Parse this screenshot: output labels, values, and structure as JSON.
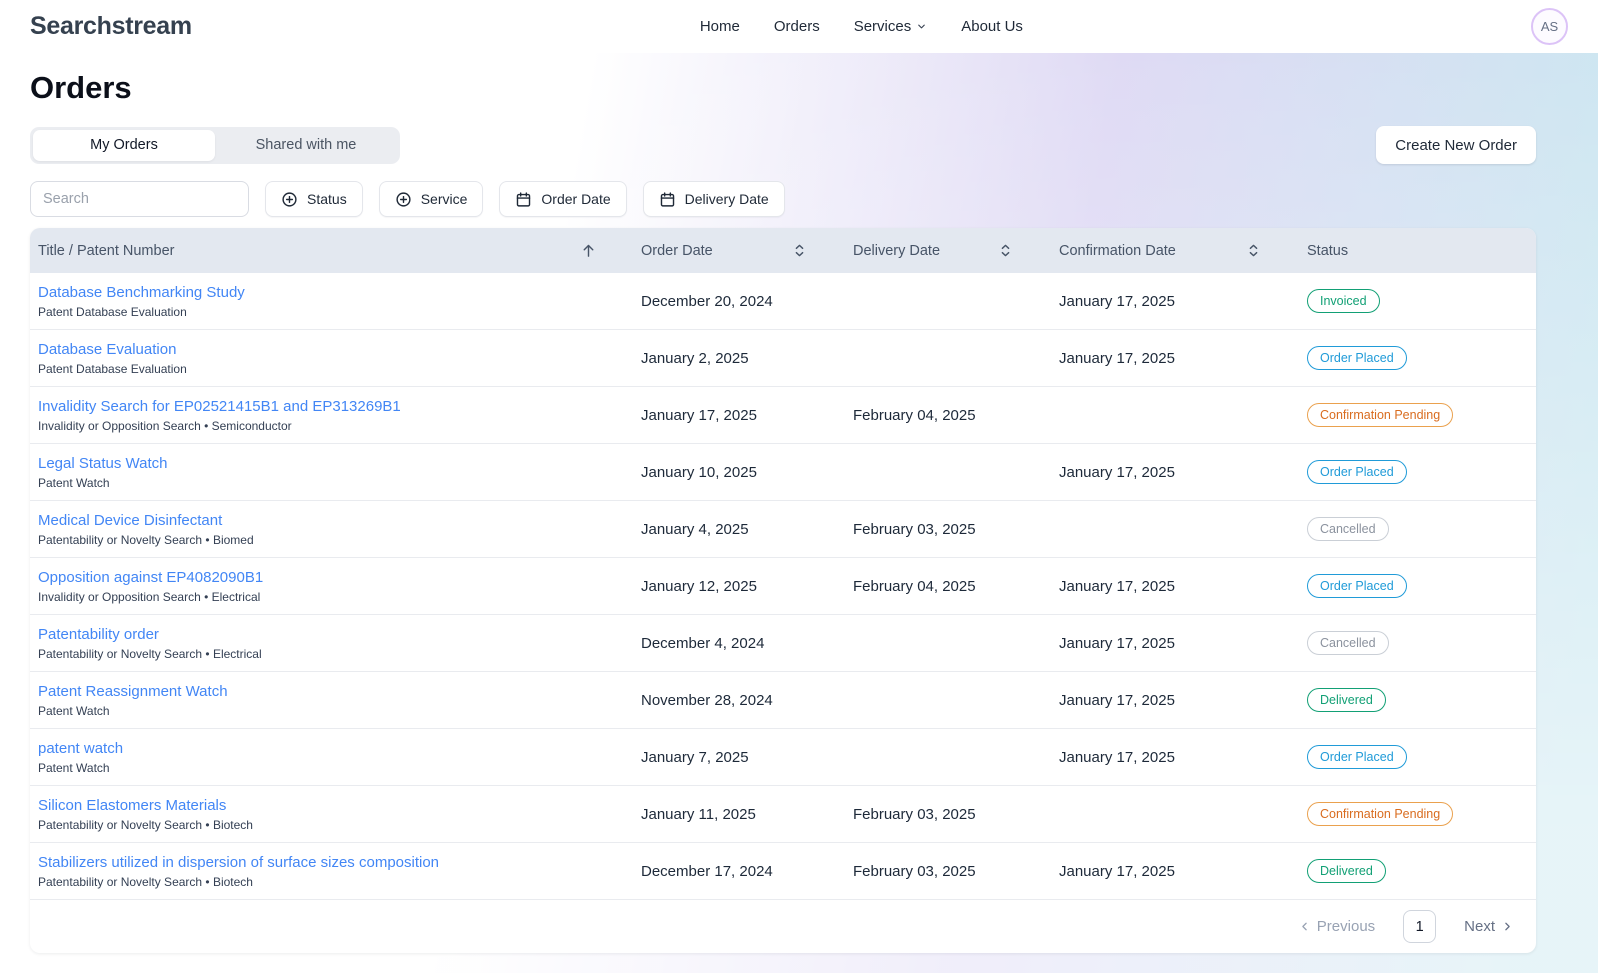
{
  "brand": {
    "logo": "Searchstream",
    "avatar_initials": "AS"
  },
  "nav": {
    "home": "Home",
    "orders": "Orders",
    "services": "Services",
    "about": "About Us"
  },
  "page": {
    "title": "Orders",
    "create_order_label": "Create New Order"
  },
  "tabs": {
    "my_orders": "My Orders",
    "shared_with_me": "Shared with me"
  },
  "filters": {
    "search_placeholder": "Search",
    "status_label": "Status",
    "service_label": "Service",
    "order_date_label": "Order Date",
    "delivery_date_label": "Delivery Date"
  },
  "table": {
    "columns": [
      "Title / Patent Number",
      "Order Date",
      "Delivery Date",
      "Confirmation Date",
      "Status"
    ],
    "sort": {
      "column": "Title / Patent Number",
      "direction": "ascending"
    },
    "rows": [
      {
        "title": "Database Benchmarking Study",
        "subtitle": "Patent Database Evaluation",
        "order_date": "December 20, 2024",
        "delivery_date": "",
        "confirmation_date": "January 17, 2025",
        "status": "Invoiced",
        "status_type": "green"
      },
      {
        "title": "Database Evaluation",
        "subtitle": "Patent Database Evaluation",
        "order_date": "January 2, 2025",
        "delivery_date": "",
        "confirmation_date": "January 17, 2025",
        "status": "Order Placed",
        "status_type": "blue"
      },
      {
        "title": "Invalidity Search for EP02521415B1 and EP313269B1",
        "subtitle": "Invalidity or Opposition Search • Semiconductor",
        "order_date": "January 17, 2025",
        "delivery_date": "February 04, 2025",
        "confirmation_date": "",
        "status": "Confirmation Pending",
        "status_type": "orange"
      },
      {
        "title": "Legal Status Watch",
        "subtitle": "Patent Watch",
        "order_date": "January 10, 2025",
        "delivery_date": "",
        "confirmation_date": "January 17, 2025",
        "status": "Order Placed",
        "status_type": "blue"
      },
      {
        "title": "Medical Device Disinfectant",
        "subtitle": "Patentability or Novelty Search • Biomed",
        "order_date": "January 4, 2025",
        "delivery_date": "February 03, 2025",
        "confirmation_date": "",
        "status": "Cancelled",
        "status_type": "gray"
      },
      {
        "title": "Opposition against EP4082090B1",
        "subtitle": "Invalidity or Opposition Search • Electrical",
        "order_date": "January 12, 2025",
        "delivery_date": "February 04, 2025",
        "confirmation_date": "January 17, 2025",
        "status": "Order Placed",
        "status_type": "blue"
      },
      {
        "title": "Patentability order",
        "subtitle": "Patentability or Novelty Search • Electrical",
        "order_date": "December 4, 2024",
        "delivery_date": "",
        "confirmation_date": "January 17, 2025",
        "status": "Cancelled",
        "status_type": "gray"
      },
      {
        "title": "Patent Reassignment Watch",
        "subtitle": "Patent Watch",
        "order_date": "November 28, 2024",
        "delivery_date": "",
        "confirmation_date": "January 17, 2025",
        "status": "Delivered",
        "status_type": "green"
      },
      {
        "title": "patent watch",
        "subtitle": "Patent Watch",
        "order_date": "January 7, 2025",
        "delivery_date": "",
        "confirmation_date": "January 17, 2025",
        "status": "Order Placed",
        "status_type": "blue"
      },
      {
        "title": "Silicon Elastomers Materials",
        "subtitle": "Patentability or Novelty Search • Biotech",
        "order_date": "January 11, 2025",
        "delivery_date": "February 03, 2025",
        "confirmation_date": "",
        "status": "Confirmation Pending",
        "status_type": "orange"
      },
      {
        "title": "Stabilizers utilized in dispersion of surface sizes composition",
        "subtitle": "Patentability or Novelty Search • Biotech",
        "order_date": "December 17, 2024",
        "delivery_date": "February 03, 2025",
        "confirmation_date": "January 17, 2025",
        "status": "Delivered",
        "status_type": "green"
      }
    ]
  },
  "pagination": {
    "previous_label": "Previous",
    "current_page": "1",
    "next_label": "Next"
  },
  "colors": {
    "accent_link": "#4286f5",
    "header_bg": "#e3e8f0",
    "avatar_ring": "#dcc3f7",
    "badge_green": "#12a075",
    "badge_blue": "#209bd8",
    "badge_orange_text": "#d96c1f",
    "badge_orange_border": "#eaa14e",
    "badge_gray_text": "#8b929e",
    "badge_gray_border": "#cacfd6"
  }
}
